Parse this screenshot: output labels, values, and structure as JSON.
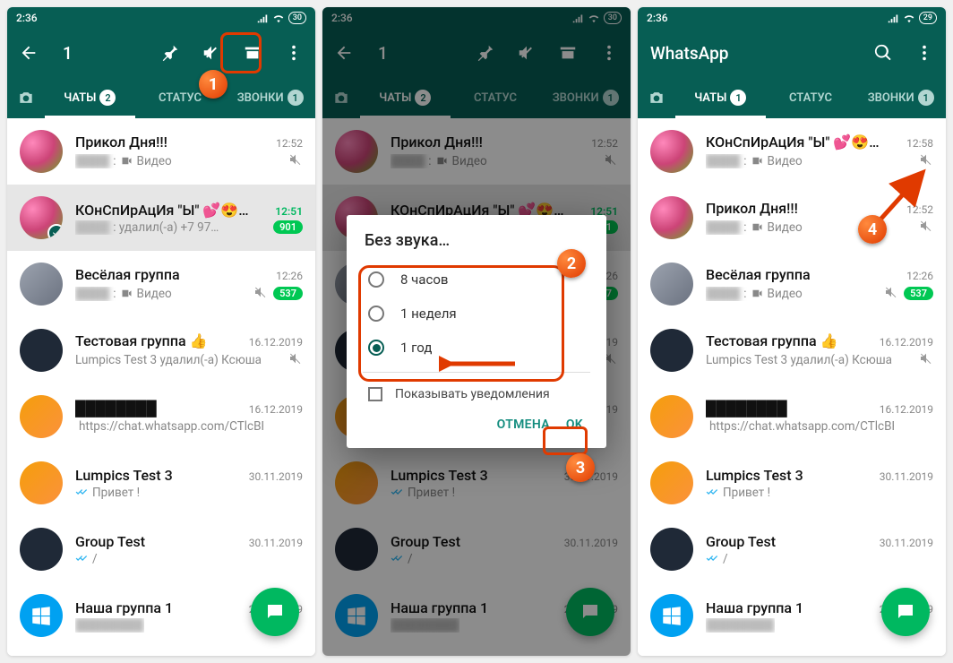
{
  "screens": [
    {
      "statusbar": {
        "time": "2:36",
        "battery": "30"
      },
      "header": {
        "mode": "selection",
        "title": "1"
      },
      "tabs": {
        "chats": "ЧАТЫ",
        "chats_badge": "2",
        "status": "СТАТУС",
        "calls": "ЗВОНКИ",
        "calls_badge": "1"
      },
      "chats": [
        {
          "title": "Прикол Дня!!!",
          "time": "12:52",
          "snippet_secondary": "Видео",
          "has_video": true,
          "muted": true,
          "blurred_sender": true
        },
        {
          "title": "КОнСпИрАцИя \"Ы\" 💕😍😊👍",
          "time": "12:51",
          "snippet": "удалил(-а) +7 97…",
          "time_unread": true,
          "badge": "901",
          "selected": true,
          "blurred_sender": true
        },
        {
          "title": "Весёлая группа",
          "time": "12:26",
          "snippet_secondary": "Видео",
          "has_video": true,
          "muted": true,
          "badge": "537",
          "blurred_sender": true
        },
        {
          "title": "Тестовая группа 👍",
          "time": "16.12.2019",
          "snippet": "Lumpics Test 3 удалил(-а) Ксюша",
          "muted": true
        },
        {
          "title": "—",
          "time": "16.12.2019",
          "snippet": "https://chat.whatsapp.com/CTlcBFu…",
          "double_check": true,
          "blurred_title": true
        },
        {
          "title": "Lumpics Test 3",
          "time": "30.11.2019",
          "snippet": "Привет !",
          "double_check": true
        },
        {
          "title": "Group Test",
          "time": "30.11.2019",
          "snippet": "/",
          "double_check": true
        },
        {
          "title": "Наша группа 1",
          "time": "20.11.2019",
          "snippet": "",
          "blurred_snippet": true
        }
      ]
    },
    {
      "statusbar": {
        "time": "2:36",
        "battery": "30"
      },
      "header": {
        "mode": "selection",
        "title": "1"
      },
      "tabs": {
        "chats": "ЧАТЫ",
        "chats_badge": "2",
        "status": "СТАТУС",
        "calls": "ЗВОНКИ",
        "calls_badge": "1"
      },
      "dialog": {
        "title": "Без звука…",
        "options": [
          "8 часов",
          "1 неделя",
          "1 год"
        ],
        "selected_index": 2,
        "checkbox_label": "Показывать уведомления",
        "cancel": "ОТМЕНА",
        "ok": "OK"
      }
    },
    {
      "statusbar": {
        "time": "2:36",
        "battery": "29"
      },
      "header": {
        "mode": "main",
        "title": "WhatsApp"
      },
      "tabs": {
        "chats": "ЧАТЫ",
        "chats_badge": "1",
        "status": "СТАТУС",
        "calls": "ЗВОНКИ",
        "calls_badge": "1"
      },
      "chats": [
        {
          "title": "КОнСпИрАцИя \"Ы\" 💕😍😊👍",
          "time": "12:58",
          "snippet_secondary": "Видео",
          "has_video": true,
          "muted": true,
          "blurred_sender": true
        },
        {
          "title": "Прикол Дня!!!",
          "time": "12:52",
          "snippet_secondary": "Видео",
          "has_video": true,
          "muted": true,
          "blurred_sender": true
        },
        {
          "title": "Весёлая группа",
          "time": "12:26",
          "snippet_secondary": "Видео",
          "has_video": true,
          "muted": true,
          "badge": "537",
          "blurred_sender": true
        },
        {
          "title": "Тестовая группа 👍",
          "time": "16.12.2019",
          "snippet": "Lumpics Test 3 удалил(-а) Ксюша",
          "muted": true
        },
        {
          "title": "—",
          "time": "16.12.2019",
          "snippet": "https://chat.whatsapp.com/CTlcBFu…",
          "double_check": true,
          "blurred_title": true
        },
        {
          "title": "Lumpics Test 3",
          "time": "30.11.2019",
          "snippet": "Привет !",
          "double_check": true
        },
        {
          "title": "Group Test",
          "time": "30.11.2019",
          "snippet": "/",
          "double_check": true
        },
        {
          "title": "Наша группа 1",
          "time": "20.11.2019",
          "snippet": "",
          "blurred_snippet": true
        }
      ]
    }
  ],
  "callouts": {
    "1": "1",
    "2": "2",
    "3": "3",
    "4": "4"
  }
}
